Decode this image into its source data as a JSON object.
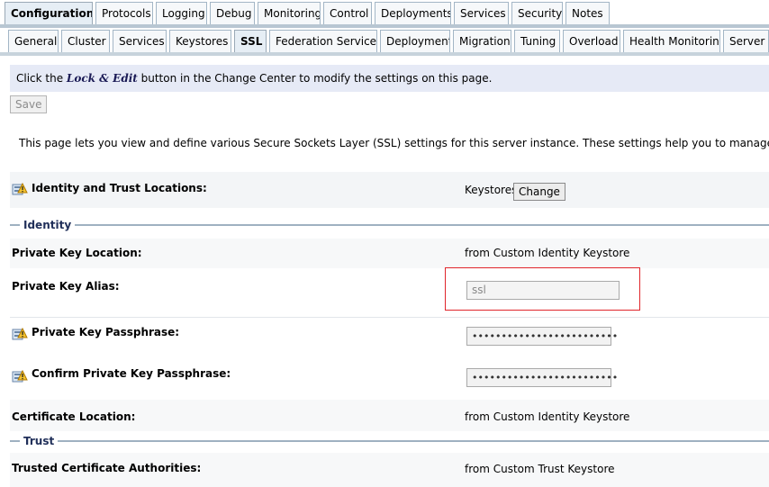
{
  "tabs_main": [
    {
      "label": "Configuration",
      "active": true
    },
    {
      "label": "Protocols"
    },
    {
      "label": "Logging"
    },
    {
      "label": "Debug"
    },
    {
      "label": "Monitoring"
    },
    {
      "label": "Control"
    },
    {
      "label": "Deployments"
    },
    {
      "label": "Services"
    },
    {
      "label": "Security"
    },
    {
      "label": "Notes"
    }
  ],
  "tabs_sub": [
    {
      "label": "General"
    },
    {
      "label": "Cluster"
    },
    {
      "label": "Services"
    },
    {
      "label": "Keystores"
    },
    {
      "label": "SSL",
      "active": true
    },
    {
      "label": "Federation Services"
    },
    {
      "label": "Deployment"
    },
    {
      "label": "Migration"
    },
    {
      "label": "Tuning"
    },
    {
      "label": "Overload"
    },
    {
      "label": "Health Monitoring"
    },
    {
      "label": "Server S"
    }
  ],
  "notice": {
    "prefix": "Click the ",
    "lock_edit": "Lock & Edit",
    "suffix": " button in the Change Center to modify the settings on this page."
  },
  "save_label": "Save",
  "intro": "This page lets you view and define various Secure Sockets Layer (SSL) settings for this server instance. These settings help you to manage the security of mess",
  "identity_trust": {
    "label": "Identity and Trust Locations:",
    "value": "Keystores",
    "change_label": "Change"
  },
  "sections": {
    "identity": "Identity",
    "trust": "Trust"
  },
  "fields": {
    "pk_location": {
      "label": "Private Key Location:",
      "value": "from Custom Identity Keystore"
    },
    "pk_alias": {
      "label": "Private Key Alias:",
      "value": "ssl"
    },
    "pk_pass": {
      "label": "Private Key Passphrase:",
      "value": "•••••••••••••••••••••••••"
    },
    "pk_confirm": {
      "label": "Confirm Private Key Passphrase:",
      "value": "•••••••••••••••••••••••••"
    },
    "cert_location": {
      "label": "Certificate Location:",
      "value": "from Custom Identity Keystore"
    },
    "trusted_ca": {
      "label": "Trusted Certificate Authorities:",
      "value": "from Custom Trust Keystore"
    }
  },
  "icons": {
    "warning": "config-warning-icon"
  },
  "colors": {
    "highlight_box": "#e0252b",
    "tab_border": "#a3b6c6",
    "notice_bg": "#e6eaf6",
    "section_title": "#21305a"
  }
}
